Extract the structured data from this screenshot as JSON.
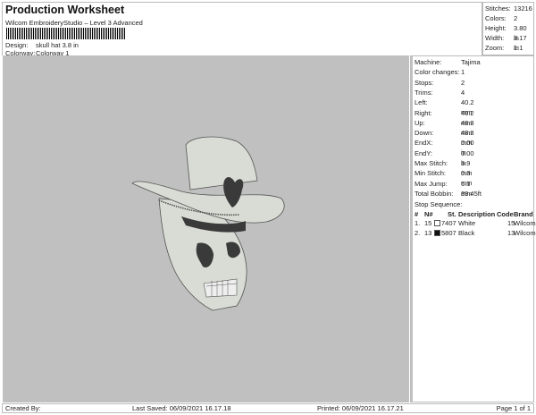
{
  "header": {
    "title": "Production Worksheet",
    "subtitle": "Wilcom EmbroideryStudio – Level 3 Advanced",
    "design_label": "Design:",
    "design_value": "skull hat 3.8 in",
    "colorway_label": "Colorway:",
    "colorway_value": "Colorway 1"
  },
  "summary": [
    {
      "label": "Stitches:",
      "value": "13216"
    },
    {
      "label": "Colors:",
      "value": "2"
    },
    {
      "label": "Height:",
      "value": "3.80 in"
    },
    {
      "label": "Width:",
      "value": "3.17 in"
    },
    {
      "label": "Zoom:",
      "value": "1:1"
    }
  ],
  "details": [
    {
      "label": "Machine:",
      "value": "Tajima"
    },
    {
      "label": "Color changes:",
      "value": "1"
    },
    {
      "label": "Stops:",
      "value": "2"
    },
    {
      "label": "Trims:",
      "value": "4"
    },
    {
      "label": "Left:",
      "value": "40.2 mm"
    },
    {
      "label": "Right:",
      "value": "40.2 mm"
    },
    {
      "label": "Up:",
      "value": "48.3 mm"
    },
    {
      "label": "Down:",
      "value": "48.3 mm"
    },
    {
      "label": "EndX:",
      "value": "0.00 in"
    },
    {
      "label": "EndY:",
      "value": "0.00 in"
    },
    {
      "label": "Max Stitch:",
      "value": "5.9 mm"
    },
    {
      "label": "Min Stitch:",
      "value": "0.3 mm"
    },
    {
      "label": "Max Jump:",
      "value": "6.1 mm"
    },
    {
      "label": "Total Bobbin:",
      "value": "89.45ft"
    }
  ],
  "stop_sequence": {
    "title": "Stop Sequence:",
    "columns": [
      "#",
      "N#",
      "St.",
      "Description",
      "Code",
      "Brand"
    ],
    "rows": [
      {
        "num": "1.",
        "n": "15",
        "swatch": "#ffffff",
        "st": "7407",
        "desc": "White",
        "code": "15",
        "brand": "Wilcom"
      },
      {
        "num": "2.",
        "n": "13",
        "swatch": "#111111",
        "st": "5807",
        "desc": "Black",
        "code": "13",
        "brand": "Wilcom"
      }
    ]
  },
  "footer": {
    "created": "Created By:",
    "saved": "Last Saved: 06/09/2021 16.17.18",
    "printed": "Printed: 06/09/2021 16.17.21",
    "page": "Page 1 of 1"
  },
  "colors": {
    "canvas": "#c0c0c0",
    "thread_fill": "#d8dcd4",
    "thread_dark": "#3a3a3a"
  }
}
